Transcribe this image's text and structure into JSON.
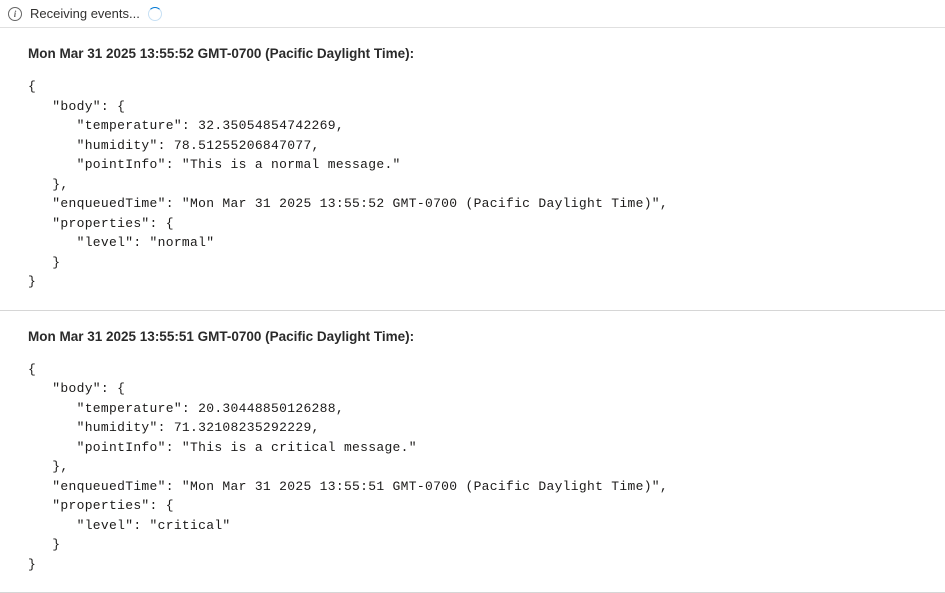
{
  "statusBar": {
    "statusText": "Receiving events..."
  },
  "events": [
    {
      "header": "Mon Mar 31 2025 13:55:52 GMT-0700 (Pacific Daylight Time):",
      "json": "{\n   \"body\": {\n      \"temperature\": 32.35054854742269,\n      \"humidity\": 78.51255206847077,\n      \"pointInfo\": \"This is a normal message.\"\n   },\n   \"enqueuedTime\": \"Mon Mar 31 2025 13:55:52 GMT-0700 (Pacific Daylight Time)\",\n   \"properties\": {\n      \"level\": \"normal\"\n   }\n}"
    },
    {
      "header": "Mon Mar 31 2025 13:55:51 GMT-0700 (Pacific Daylight Time):",
      "json": "{\n   \"body\": {\n      \"temperature\": 20.30448850126288,\n      \"humidity\": 71.32108235292229,\n      \"pointInfo\": \"This is a critical message.\"\n   },\n   \"enqueuedTime\": \"Mon Mar 31 2025 13:55:51 GMT-0700 (Pacific Daylight Time)\",\n   \"properties\": {\n      \"level\": \"critical\"\n   }\n}"
    }
  ]
}
